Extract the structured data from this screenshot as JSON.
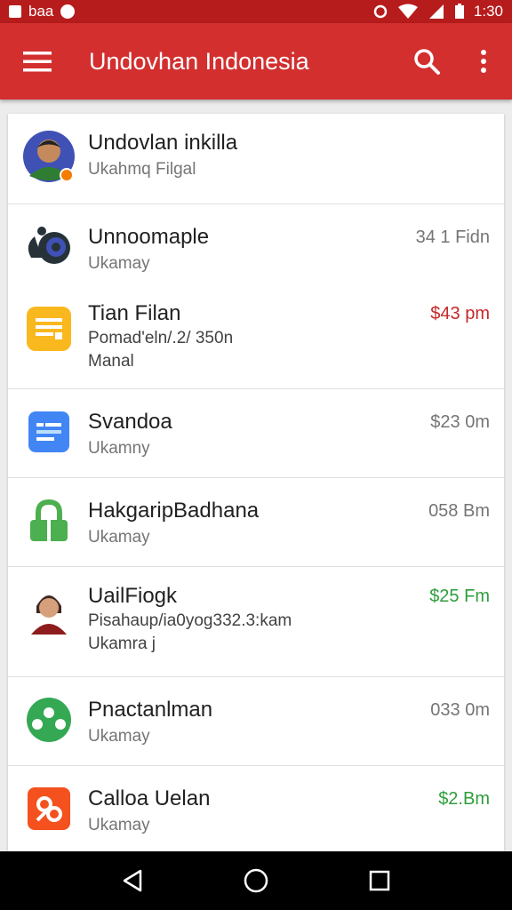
{
  "status_bar": {
    "left_text": "baa",
    "time": "1:30"
  },
  "app_bar": {
    "title": "Undovhan Indonesia",
    "menu_icon": "hamburger-menu-icon",
    "search_icon": "search-icon",
    "overflow_icon": "more-vert-icon"
  },
  "accent": "#d32f2f",
  "items": [
    {
      "title": "Undovlan inkilla",
      "subtitle": "Ukahmq Filgal",
      "meta": "",
      "meta_color": "",
      "icon": "user-avatar-icon"
    },
    {
      "title": "Unnoomaple",
      "subtitle": "Ukamay",
      "meta": "34 1 Fidn",
      "meta_color": "gray",
      "icon": "app-logo-icon"
    },
    {
      "title": "Tian Filan",
      "subtitle": "Pomad'eln/.2/ 350n",
      "subtitle2": "Manal",
      "meta": "$43 pm",
      "meta_color": "red",
      "icon": "document-icon"
    },
    {
      "title": "Svandoa",
      "subtitle": "Ukamny",
      "meta": "$23 0m",
      "meta_color": "gray",
      "icon": "calendar-icon"
    },
    {
      "title": "HakgaripBadhana",
      "subtitle": "Ukamay",
      "meta": "058 Bm",
      "meta_color": "gray",
      "icon": "lock-icon"
    },
    {
      "title": "UailFiogk",
      "subtitle": "Pisahaup/ia0yog332.3:kam",
      "subtitle2": "Ukamra j",
      "meta": "$25 Fm",
      "meta_color": "green",
      "icon": "person-avatar-icon"
    },
    {
      "title": "Pnactanlman",
      "subtitle": "Ukamay",
      "meta": "033 0m",
      "meta_color": "gray",
      "icon": "people-icon"
    },
    {
      "title": "Calloa Uelan",
      "subtitle": "Ukamay",
      "meta": "$2.Bm",
      "meta_color": "green",
      "icon": "share-icon"
    }
  ],
  "nav_bar": {
    "back_icon": "back-triangle-icon",
    "home_icon": "home-circle-icon",
    "recents_icon": "recents-square-icon"
  }
}
